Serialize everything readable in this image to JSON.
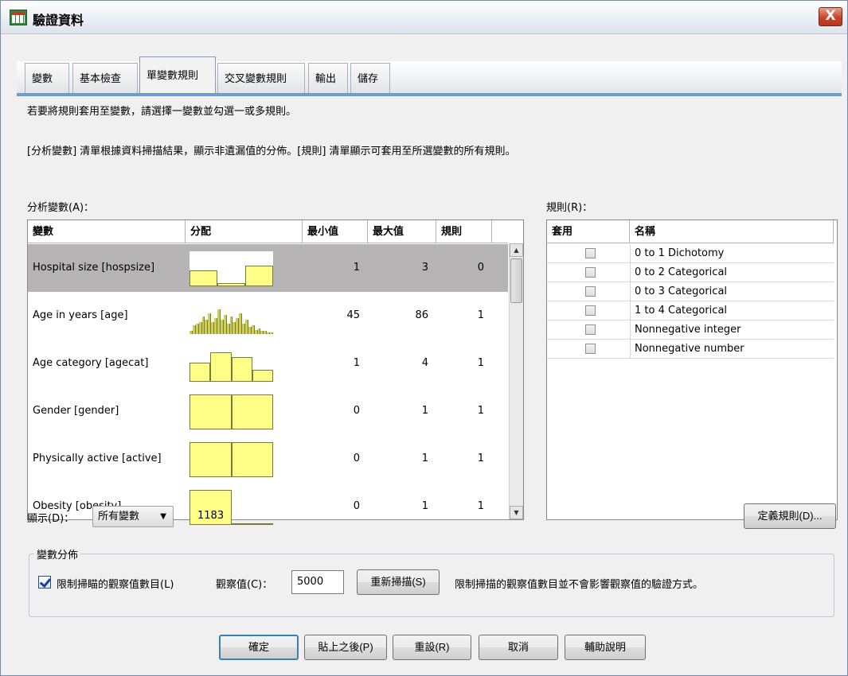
{
  "window": {
    "title": "驗證資料",
    "close_label": "X"
  },
  "tabs": [
    {
      "label": "變數"
    },
    {
      "label": "基本檢查"
    },
    {
      "label": "單變數規則"
    },
    {
      "label": "交叉變數規則"
    },
    {
      "label": "輸出"
    },
    {
      "label": "儲存"
    }
  ],
  "active_tab": "單變數規則",
  "instructions": {
    "line1": "若要將規則套用至變數，請選擇一變數並勾選一或多規則。",
    "line2": "[分析變數] 清單根據資料掃描結果，顯示非遺漏值的分佈。[規則] 清單顯示可套用至所選變數的所有規則。"
  },
  "analysis_vars": {
    "label": "分析變數(A)：",
    "columns": [
      "變數",
      "分配",
      "最小值",
      "最大值",
      "規則"
    ],
    "rows": [
      {
        "name": "Hospital size [hospsize]",
        "min": "1",
        "max": "3",
        "rules": "0",
        "dist": [
          0.45,
          0.1,
          0.6
        ],
        "selected": true
      },
      {
        "name": "Age in years [age]",
        "min": "45",
        "max": "86",
        "rules": "1",
        "dist": [
          0.1,
          0.25,
          0.3,
          0.35,
          0.5,
          0.4,
          0.6,
          0.35,
          0.45,
          0.7,
          0.4,
          0.55,
          0.3,
          0.5,
          0.35,
          0.45,
          0.6,
          0.3,
          0.4,
          0.2,
          0.25,
          0.12,
          0.15,
          0.08,
          0.1,
          0.05,
          0.04
        ],
        "selected": false
      },
      {
        "name": "Age category [agecat]",
        "min": "1",
        "max": "4",
        "rules": "1",
        "dist": [
          0.55,
          0.85,
          0.7,
          0.35
        ],
        "selected": false
      },
      {
        "name": "Gender [gender]",
        "min": "0",
        "max": "1",
        "rules": "1",
        "dist": [
          1.0,
          1.0
        ],
        "selected": false
      },
      {
        "name": "Physically active [active]",
        "min": "0",
        "max": "1",
        "rules": "1",
        "dist": [
          1.0,
          1.0
        ],
        "selected": false
      },
      {
        "name": "Obesity [obesity]",
        "min": "0",
        "max": "1",
        "rules": "1",
        "dist": [
          1.0,
          0.02
        ],
        "selected": false
      }
    ]
  },
  "rules": {
    "label": "規則(R)：",
    "columns": [
      "套用",
      "名稱"
    ],
    "rows": [
      {
        "name": "0 to 1 Dichotomy",
        "checked": false
      },
      {
        "name": "0 to 2 Categorical",
        "checked": false
      },
      {
        "name": "0 to 3 Categorical",
        "checked": false
      },
      {
        "name": "1 to 4 Categorical",
        "checked": false
      },
      {
        "name": "Nonnegative integer",
        "checked": false
      },
      {
        "name": "Nonnegative number",
        "checked": false
      }
    ],
    "define_button": "定義規則(D)..."
  },
  "display": {
    "label": "顯示(D)：",
    "selected": "所有變數",
    "count": "1183"
  },
  "distribution_group": {
    "title": "變數分佈",
    "limit_checkbox_label": "限制掃瞄的觀察值數目(L)",
    "limit_checked": true,
    "cases_label": "觀察值(C)：",
    "cases_value": "5000",
    "rescan_button": "重新掃描(S)",
    "note": "限制掃描的觀察值數目並不會影響觀察值的驗證方式。"
  },
  "footer_buttons": {
    "ok": "確定",
    "paste": "貼上之後(P)",
    "reset": "重設(R)",
    "cancel": "取消",
    "help": "輔助說明"
  },
  "colors": {
    "accent": "#6c9ecb",
    "bar_fill": "#ffff88",
    "selected_row": "#b5b3b3"
  }
}
